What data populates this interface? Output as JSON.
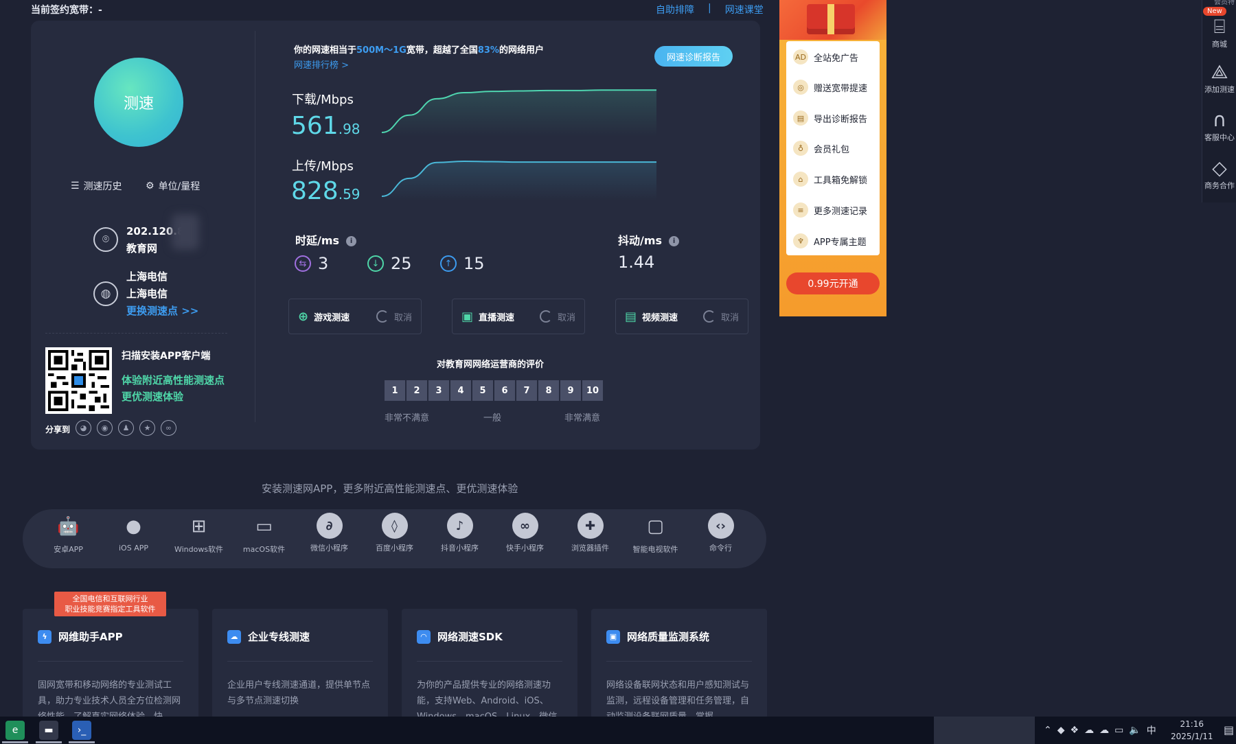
{
  "header": {
    "current_plan": "当前签约宽带：-",
    "links": [
      "自助排障",
      "网速课堂"
    ],
    "separator": "|"
  },
  "left_panel": {
    "speed_button": "测速",
    "history_label": "测速历史",
    "unit_label": "单位/量程",
    "ip": "202.120.8",
    "network_type": "教育网",
    "isp_line1": "上海电信",
    "isp_line2": "上海电信",
    "change_node": "更换测速点 >>",
    "qr_title": "扫描安装APP客户端",
    "qr_line1": "体验附近高性能测速点",
    "qr_line2": "更优测速体验",
    "share_label": "分享到"
  },
  "result": {
    "summary_prefix": "你的网速相当于",
    "summary_range": "500M～1G",
    "summary_mid": "宽带，超越了全国",
    "summary_percent": "83%",
    "summary_suffix": "的网络用户",
    "rank_link": "网速排行榜 >",
    "diag_button": "网速诊断报告",
    "download_label": "下载/Mbps",
    "download_int": "561",
    "download_dec": ".98",
    "upload_label": "上传/Mbps",
    "upload_int": "828",
    "upload_dec": ".59",
    "latency_label": "时延/ms",
    "latency_ping": "3",
    "latency_down": "25",
    "latency_up": "15",
    "jitter_label": "抖动/ms",
    "jitter_value": "1.44",
    "tests": [
      {
        "label": "游戏测速",
        "cancel": "取消"
      },
      {
        "label": "直播测速",
        "cancel": "取消"
      },
      {
        "label": "视频测速",
        "cancel": "取消"
      }
    ],
    "rating_title": "对教育网网络运营商的评价",
    "rating_values": [
      "1",
      "2",
      "3",
      "4",
      "5",
      "6",
      "7",
      "8",
      "9",
      "10"
    ],
    "rating_low": "非常不满意",
    "rating_mid": "一般",
    "rating_high": "非常满意"
  },
  "promo": {
    "items": [
      "全站免广告",
      "赠送宽带提速",
      "导出诊断报告",
      "会员礼包",
      "工具箱免解锁",
      "更多测速记录",
      "APP专属主题"
    ],
    "button": "0.99元开通"
  },
  "right_bar": {
    "badge": "New",
    "top_text": "会员特",
    "items": [
      "商城",
      "添加测速",
      "客服中心",
      "商务合作"
    ]
  },
  "apps": {
    "install_text": "安装测速网APP，更多附近高性能测速点、更优测速体验",
    "items": [
      "安卓APP",
      "iOS APP",
      "Windows软件",
      "macOS软件",
      "微信小程序",
      "百度小程序",
      "抖音小程序",
      "快手小程序",
      "浏览器插件",
      "智能电视软件",
      "命令行"
    ]
  },
  "products": {
    "award_line1": "全国电信和互联网行业",
    "award_line2": "职业技能竞赛指定工具软件",
    "cards": [
      {
        "title": "网维助手APP",
        "desc": "固网宽带和移动网络的专业测试工具，助力专业技术人员全方位检测网络性能，了解真实网络体验，快"
      },
      {
        "title": "企业专线测速",
        "desc": "企业用户专线测速通道，提供单节点与多节点测速切换"
      },
      {
        "title": "网络测速SDK",
        "desc": "为你的产品提供专业的网络测速功能，支持Web、Android、iOS、Windows、macOS、Linux、微信"
      },
      {
        "title": "网络质量监测系统",
        "desc": "网络设备联网状态和用户感知测试与监测，远程设备管理和任务管理，自动监测设备联网质量，掌握"
      }
    ]
  },
  "taskbar": {
    "time": "21:16",
    "date": "2025/1/11",
    "ime": "中"
  },
  "colors": {
    "accent": "#3d9cf0",
    "speed_value": "#5fd8e8",
    "green": "#4fd6a8",
    "promo_button": "#e8472d"
  },
  "chart_data": [
    {
      "type": "line",
      "title": "下载/Mbps",
      "x": [
        0,
        1,
        2,
        3,
        4,
        5,
        6,
        7,
        8,
        9,
        10
      ],
      "y": [
        0,
        40,
        78,
        92,
        95,
        96,
        97,
        97,
        98,
        98,
        98
      ]
    },
    {
      "type": "line",
      "title": "上传/Mbps",
      "x": [
        0,
        1,
        2,
        3,
        4,
        5,
        6,
        7,
        8,
        9,
        10
      ],
      "y": [
        0,
        45,
        85,
        88,
        87,
        86,
        86,
        86,
        86,
        86,
        86
      ]
    }
  ]
}
